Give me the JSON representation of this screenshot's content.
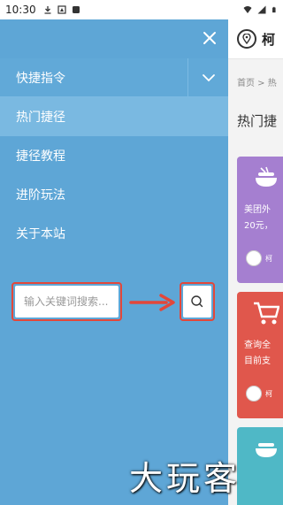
{
  "status_bar": {
    "time": "10:30",
    "icons_left": [
      "download-icon",
      "warning-icon",
      "notification-square-icon"
    ],
    "icons_right": [
      "wifi-icon",
      "signal-icon",
      "battery-icon"
    ]
  },
  "background_page": {
    "site_title": "柯",
    "breadcrumb": "首页 >  热",
    "section_title": "热门捷",
    "cards": [
      {
        "color": "#a57fd0",
        "icon": "food-bowl-icon",
        "line1": "美团外",
        "line2": "20元，",
        "author": "柯"
      },
      {
        "color": "#e0574c",
        "icon": "shopping-cart-icon",
        "line1": "查询全",
        "line2": "目前支",
        "author": "柯"
      },
      {
        "color": "#4fb8c6",
        "icon": "food-bowl-icon"
      }
    ]
  },
  "drawer": {
    "close_icon": "close-icon",
    "menu": [
      {
        "label": "快捷指令",
        "expandable": true
      },
      {
        "label": "热门捷径",
        "active": true
      },
      {
        "label": "捷径教程"
      },
      {
        "label": "进阶玩法"
      },
      {
        "label": "关于本站"
      }
    ],
    "search": {
      "placeholder": "输入关键词搜索...",
      "button_icon": "search-icon"
    }
  },
  "watermark": "大玩客",
  "colors": {
    "drawer_bg": "#5ea6d6",
    "active_item": "#7ab9e1",
    "highlight_border": "#e3473a"
  }
}
